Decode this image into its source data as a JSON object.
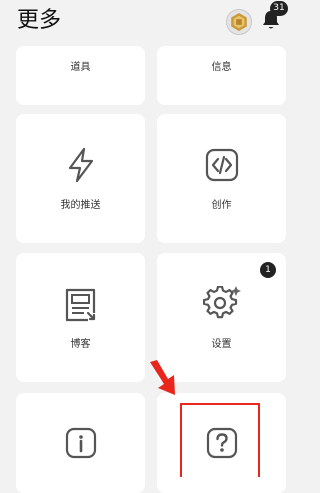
{
  "header": {
    "title": "更多",
    "notification_count": "31"
  },
  "tiles": [
    {
      "label": "道具",
      "icon": "inventory-icon"
    },
    {
      "label": "信息",
      "icon": "message-icon"
    },
    {
      "label": "我的推送",
      "icon": "lightning-icon"
    },
    {
      "label": "创作",
      "icon": "code-icon"
    },
    {
      "label": "博客",
      "icon": "blog-icon"
    },
    {
      "label": "设置",
      "icon": "gear-icon",
      "badge": "1"
    },
    {
      "label": "",
      "icon": "info-icon"
    },
    {
      "label": "",
      "icon": "help-icon"
    }
  ],
  "colors": {
    "background": "#f2f2f2",
    "tile": "#ffffff",
    "highlight": "#e8261d",
    "icon": "#555555"
  }
}
